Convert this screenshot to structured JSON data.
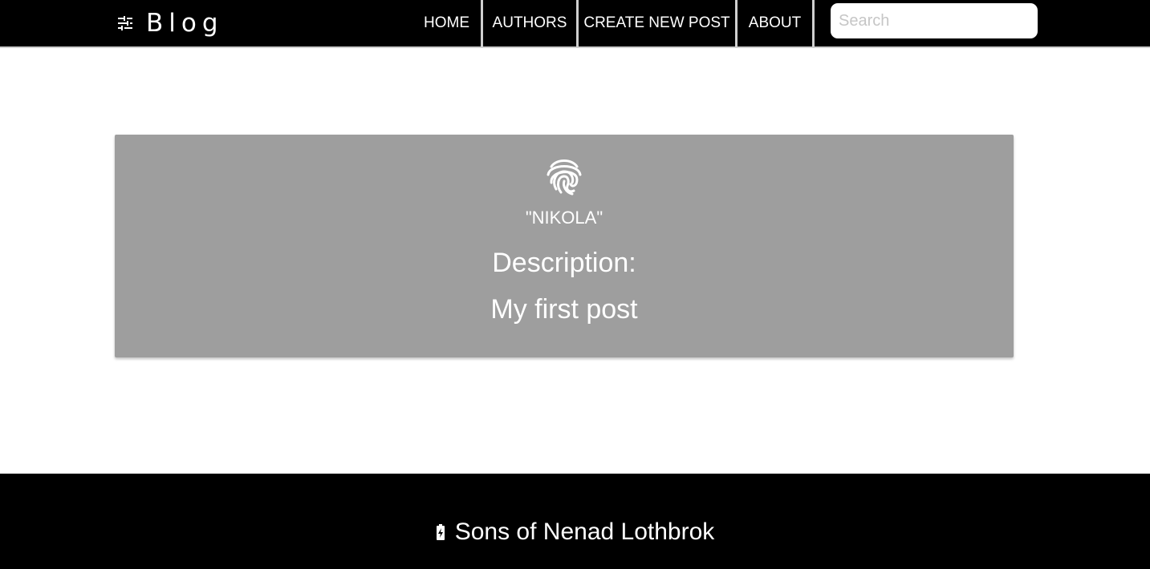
{
  "navbar": {
    "brand": {
      "icon": "tune-sliders-icon",
      "label": "Blog"
    },
    "links": [
      {
        "label": "HOME"
      },
      {
        "label": "AUTHORS"
      },
      {
        "label": "CREATE NEW POST"
      },
      {
        "label": "ABOUT"
      }
    ],
    "search": {
      "placeholder": "Search",
      "value": ""
    }
  },
  "post": {
    "icon": "fingerprint-icon",
    "author": "\"NIKOLA\"",
    "description_label": "Description:",
    "description": "My first post"
  },
  "footer": {
    "icon": "battery-charging-icon",
    "text": "Sons of Nenad Lothbrok"
  },
  "colors": {
    "navbar_bg": "#000000",
    "card_bg": "#9e9e9e",
    "footer_bg": "#000000",
    "separator": "#cfcfcf",
    "text": "#ffffff"
  }
}
